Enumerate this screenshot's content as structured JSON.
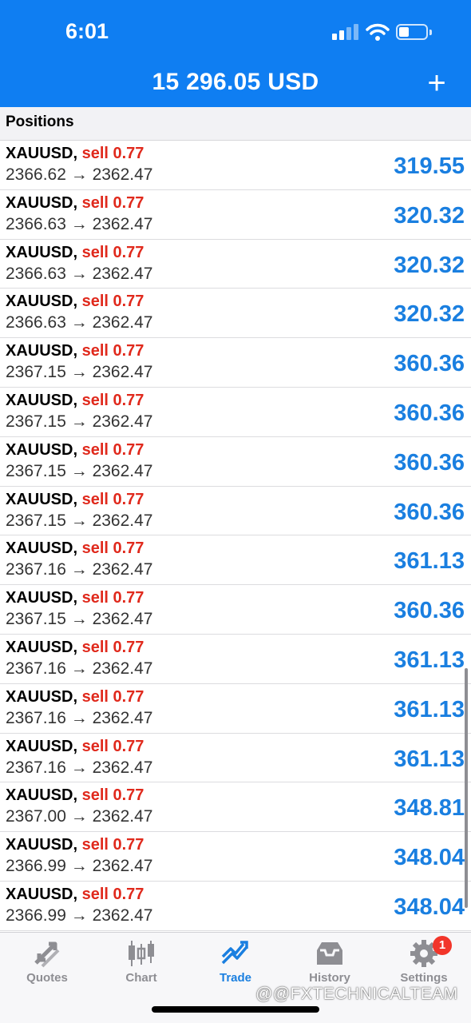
{
  "status_bar": {
    "time": "6:01"
  },
  "header": {
    "balance": "15 296.05 USD",
    "add_label": "+"
  },
  "section": {
    "title": "Positions"
  },
  "positions": [
    {
      "symbol": "XAUUSD,",
      "side": "sell 0.77",
      "prices": "2366.62 → 2362.47",
      "profit": "319.55"
    },
    {
      "symbol": "XAUUSD,",
      "side": "sell 0.77",
      "prices": "2366.63 → 2362.47",
      "profit": "320.32"
    },
    {
      "symbol": "XAUUSD,",
      "side": "sell 0.77",
      "prices": "2366.63 → 2362.47",
      "profit": "320.32"
    },
    {
      "symbol": "XAUUSD,",
      "side": "sell 0.77",
      "prices": "2366.63 → 2362.47",
      "profit": "320.32"
    },
    {
      "symbol": "XAUUSD,",
      "side": "sell 0.77",
      "prices": "2367.15 → 2362.47",
      "profit": "360.36"
    },
    {
      "symbol": "XAUUSD,",
      "side": "sell 0.77",
      "prices": "2367.15 → 2362.47",
      "profit": "360.36"
    },
    {
      "symbol": "XAUUSD,",
      "side": "sell 0.77",
      "prices": "2367.15 → 2362.47",
      "profit": "360.36"
    },
    {
      "symbol": "XAUUSD,",
      "side": "sell 0.77",
      "prices": "2367.15 → 2362.47",
      "profit": "360.36"
    },
    {
      "symbol": "XAUUSD,",
      "side": "sell 0.77",
      "prices": "2367.16 → 2362.47",
      "profit": "361.13"
    },
    {
      "symbol": "XAUUSD,",
      "side": "sell 0.77",
      "prices": "2367.15 → 2362.47",
      "profit": "360.36"
    },
    {
      "symbol": "XAUUSD,",
      "side": "sell 0.77",
      "prices": "2367.16 → 2362.47",
      "profit": "361.13"
    },
    {
      "symbol": "XAUUSD,",
      "side": "sell 0.77",
      "prices": "2367.16 → 2362.47",
      "profit": "361.13"
    },
    {
      "symbol": "XAUUSD,",
      "side": "sell 0.77",
      "prices": "2367.16 → 2362.47",
      "profit": "361.13"
    },
    {
      "symbol": "XAUUSD,",
      "side": "sell 0.77",
      "prices": "2367.00 → 2362.47",
      "profit": "348.81"
    },
    {
      "symbol": "XAUUSD,",
      "side": "sell 0.77",
      "prices": "2366.99 → 2362.47",
      "profit": "348.04"
    },
    {
      "symbol": "XAUUSD,",
      "side": "sell 0.77",
      "prices": "2366.99 → 2362.47",
      "profit": "348.04"
    }
  ],
  "tabs": [
    {
      "label": "Quotes",
      "icon": "quotes-icon",
      "active": false
    },
    {
      "label": "Chart",
      "icon": "chart-icon",
      "active": false
    },
    {
      "label": "Trade",
      "icon": "trade-icon",
      "active": true
    },
    {
      "label": "History",
      "icon": "history-icon",
      "active": false
    },
    {
      "label": "Settings",
      "icon": "settings-icon",
      "active": false
    }
  ],
  "settings_badge": "1",
  "watermark": "@@FXTECHNICALTEAM",
  "colors": {
    "header": "#0f7ef2",
    "sell": "#e0291c",
    "profit": "#1a7fe0",
    "tab_inactive": "#8e8e93",
    "badge": "#f2352a"
  }
}
